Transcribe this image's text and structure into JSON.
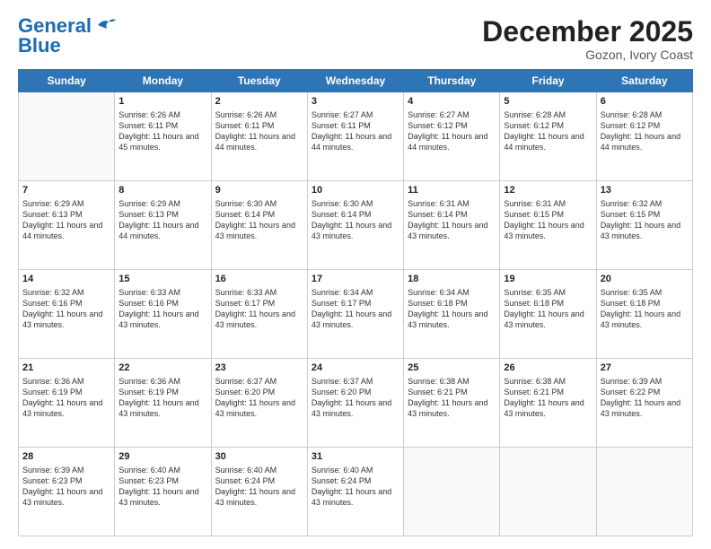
{
  "logo": {
    "line1": "General",
    "line2": "Blue"
  },
  "header": {
    "month_year": "December 2025",
    "location": "Gozon, Ivory Coast"
  },
  "days_of_week": [
    "Sunday",
    "Monday",
    "Tuesday",
    "Wednesday",
    "Thursday",
    "Friday",
    "Saturday"
  ],
  "weeks": [
    [
      {
        "day": "",
        "info": ""
      },
      {
        "day": "1",
        "info": "Sunrise: 6:26 AM\nSunset: 6:11 PM\nDaylight: 11 hours and 45 minutes."
      },
      {
        "day": "2",
        "info": "Sunrise: 6:26 AM\nSunset: 6:11 PM\nDaylight: 11 hours and 44 minutes."
      },
      {
        "day": "3",
        "info": "Sunrise: 6:27 AM\nSunset: 6:11 PM\nDaylight: 11 hours and 44 minutes."
      },
      {
        "day": "4",
        "info": "Sunrise: 6:27 AM\nSunset: 6:12 PM\nDaylight: 11 hours and 44 minutes."
      },
      {
        "day": "5",
        "info": "Sunrise: 6:28 AM\nSunset: 6:12 PM\nDaylight: 11 hours and 44 minutes."
      },
      {
        "day": "6",
        "info": "Sunrise: 6:28 AM\nSunset: 6:12 PM\nDaylight: 11 hours and 44 minutes."
      }
    ],
    [
      {
        "day": "7",
        "info": "Sunrise: 6:29 AM\nSunset: 6:13 PM\nDaylight: 11 hours and 44 minutes."
      },
      {
        "day": "8",
        "info": "Sunrise: 6:29 AM\nSunset: 6:13 PM\nDaylight: 11 hours and 44 minutes."
      },
      {
        "day": "9",
        "info": "Sunrise: 6:30 AM\nSunset: 6:14 PM\nDaylight: 11 hours and 43 minutes."
      },
      {
        "day": "10",
        "info": "Sunrise: 6:30 AM\nSunset: 6:14 PM\nDaylight: 11 hours and 43 minutes."
      },
      {
        "day": "11",
        "info": "Sunrise: 6:31 AM\nSunset: 6:14 PM\nDaylight: 11 hours and 43 minutes."
      },
      {
        "day": "12",
        "info": "Sunrise: 6:31 AM\nSunset: 6:15 PM\nDaylight: 11 hours and 43 minutes."
      },
      {
        "day": "13",
        "info": "Sunrise: 6:32 AM\nSunset: 6:15 PM\nDaylight: 11 hours and 43 minutes."
      }
    ],
    [
      {
        "day": "14",
        "info": "Sunrise: 6:32 AM\nSunset: 6:16 PM\nDaylight: 11 hours and 43 minutes."
      },
      {
        "day": "15",
        "info": "Sunrise: 6:33 AM\nSunset: 6:16 PM\nDaylight: 11 hours and 43 minutes."
      },
      {
        "day": "16",
        "info": "Sunrise: 6:33 AM\nSunset: 6:17 PM\nDaylight: 11 hours and 43 minutes."
      },
      {
        "day": "17",
        "info": "Sunrise: 6:34 AM\nSunset: 6:17 PM\nDaylight: 11 hours and 43 minutes."
      },
      {
        "day": "18",
        "info": "Sunrise: 6:34 AM\nSunset: 6:18 PM\nDaylight: 11 hours and 43 minutes."
      },
      {
        "day": "19",
        "info": "Sunrise: 6:35 AM\nSunset: 6:18 PM\nDaylight: 11 hours and 43 minutes."
      },
      {
        "day": "20",
        "info": "Sunrise: 6:35 AM\nSunset: 6:18 PM\nDaylight: 11 hours and 43 minutes."
      }
    ],
    [
      {
        "day": "21",
        "info": "Sunrise: 6:36 AM\nSunset: 6:19 PM\nDaylight: 11 hours and 43 minutes."
      },
      {
        "day": "22",
        "info": "Sunrise: 6:36 AM\nSunset: 6:19 PM\nDaylight: 11 hours and 43 minutes."
      },
      {
        "day": "23",
        "info": "Sunrise: 6:37 AM\nSunset: 6:20 PM\nDaylight: 11 hours and 43 minutes."
      },
      {
        "day": "24",
        "info": "Sunrise: 6:37 AM\nSunset: 6:20 PM\nDaylight: 11 hours and 43 minutes."
      },
      {
        "day": "25",
        "info": "Sunrise: 6:38 AM\nSunset: 6:21 PM\nDaylight: 11 hours and 43 minutes."
      },
      {
        "day": "26",
        "info": "Sunrise: 6:38 AM\nSunset: 6:21 PM\nDaylight: 11 hours and 43 minutes."
      },
      {
        "day": "27",
        "info": "Sunrise: 6:39 AM\nSunset: 6:22 PM\nDaylight: 11 hours and 43 minutes."
      }
    ],
    [
      {
        "day": "28",
        "info": "Sunrise: 6:39 AM\nSunset: 6:23 PM\nDaylight: 11 hours and 43 minutes."
      },
      {
        "day": "29",
        "info": "Sunrise: 6:40 AM\nSunset: 6:23 PM\nDaylight: 11 hours and 43 minutes."
      },
      {
        "day": "30",
        "info": "Sunrise: 6:40 AM\nSunset: 6:24 PM\nDaylight: 11 hours and 43 minutes."
      },
      {
        "day": "31",
        "info": "Sunrise: 6:40 AM\nSunset: 6:24 PM\nDaylight: 11 hours and 43 minutes."
      },
      {
        "day": "",
        "info": ""
      },
      {
        "day": "",
        "info": ""
      },
      {
        "day": "",
        "info": ""
      }
    ]
  ]
}
